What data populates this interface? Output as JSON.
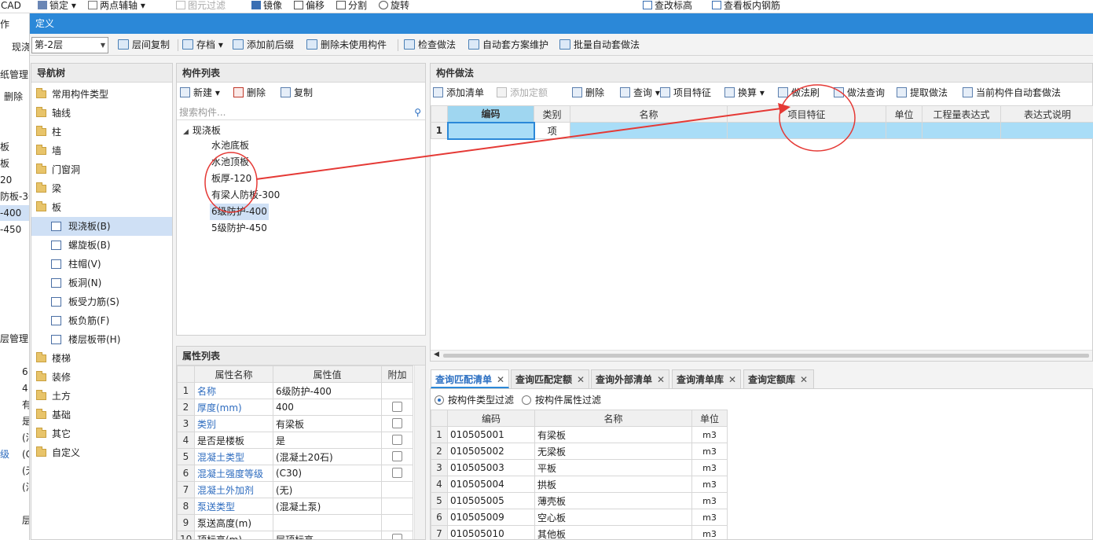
{
  "ribbon": {
    "items": [
      "CAD",
      "锁定",
      "两点辅轴",
      "图元过滤",
      "镜像",
      "偏移",
      "分割",
      "旋转",
      "查改标高",
      "查看板内钢筋"
    ]
  },
  "window": {
    "title": "定义"
  },
  "left_strip": {
    "items": [
      "作",
      "现浇",
      "纸管理",
      "删除",
      "板",
      "板",
      "20",
      "防板-30",
      "-400",
      "-450",
      "层管理",
      "6",
      "4",
      "有",
      "是",
      "(泊",
      "级",
      "(C",
      "(无",
      "(泊",
      "层"
    ]
  },
  "toolbar": {
    "floor_select": "第-2层",
    "buttons": [
      "层间复制",
      "存档",
      "添加前后缀",
      "删除未使用构件",
      "检查做法",
      "自动套方案维护",
      "批量自动套做法"
    ]
  },
  "nav_tree": {
    "title": "导航树",
    "items": [
      {
        "label": "常用构件类型",
        "kind": "folder"
      },
      {
        "label": "轴线",
        "kind": "folder"
      },
      {
        "label": "柱",
        "kind": "folder"
      },
      {
        "label": "墙",
        "kind": "folder"
      },
      {
        "label": "门窗洞",
        "kind": "folder"
      },
      {
        "label": "梁",
        "kind": "folder"
      },
      {
        "label": "板",
        "kind": "folder"
      },
      {
        "label": "现浇板(B)",
        "kind": "sub",
        "selected": true
      },
      {
        "label": "螺旋板(B)",
        "kind": "sub"
      },
      {
        "label": "柱帽(V)",
        "kind": "sub"
      },
      {
        "label": "板洞(N)",
        "kind": "sub"
      },
      {
        "label": "板受力筋(S)",
        "kind": "sub"
      },
      {
        "label": "板负筋(F)",
        "kind": "sub"
      },
      {
        "label": "楼层板带(H)",
        "kind": "sub"
      },
      {
        "label": "楼梯",
        "kind": "folder"
      },
      {
        "label": "装修",
        "kind": "folder"
      },
      {
        "label": "土方",
        "kind": "folder"
      },
      {
        "label": "基础",
        "kind": "folder"
      },
      {
        "label": "其它",
        "kind": "folder"
      },
      {
        "label": "自定义",
        "kind": "folder"
      }
    ]
  },
  "component_list": {
    "title": "构件列表",
    "new_label": "新建",
    "delete_label": "删除",
    "copy_label": "复制",
    "search_placeholder": "搜索构件...",
    "root": "现浇板",
    "items": [
      {
        "label": "水池底板"
      },
      {
        "label": "水池顶板"
      },
      {
        "label": "板厚-120"
      },
      {
        "label": "有梁人防板-300"
      },
      {
        "label": "6级防护-400",
        "selected": true
      },
      {
        "label": "5级防护-450"
      }
    ]
  },
  "properties": {
    "title": "属性列表",
    "headers": [
      "属性名称",
      "属性值",
      "附加"
    ],
    "rows": [
      {
        "num": "1",
        "name": "名称",
        "value": "6级防护-400",
        "link": true,
        "check": false
      },
      {
        "num": "2",
        "name": "厚度(mm)",
        "value": "400",
        "link": true,
        "check": true
      },
      {
        "num": "3",
        "name": "类别",
        "value": "有梁板",
        "link": true,
        "check": true
      },
      {
        "num": "4",
        "name": "是否是楼板",
        "value": "是",
        "link": false,
        "check": true
      },
      {
        "num": "5",
        "name": "混凝土类型",
        "value": "(混凝土20石)",
        "link": true,
        "check": true
      },
      {
        "num": "6",
        "name": "混凝土强度等级",
        "value": "(C30)",
        "link": true,
        "check": true
      },
      {
        "num": "7",
        "name": "混凝土外加剂",
        "value": "(无)",
        "link": true,
        "check": false
      },
      {
        "num": "8",
        "name": "泵送类型",
        "value": "(混凝土泵)",
        "link": true,
        "check": false
      },
      {
        "num": "9",
        "name": "泵送高度(m)",
        "value": "",
        "link": false,
        "check": false
      },
      {
        "num": "10",
        "name": "顶标高(m)",
        "value": "层顶标高",
        "link": false,
        "check": true
      }
    ]
  },
  "methods": {
    "title": "构件做法",
    "tools": [
      "添加清单",
      "添加定额",
      "删除",
      "查询",
      "项目特征",
      "换算",
      "做法刷",
      "做法查询",
      "提取做法",
      "当前构件自动套做法"
    ],
    "headers": [
      "编码",
      "类别",
      "名称",
      "项目特征",
      "单位",
      "工程量表达式",
      "表达式说明"
    ],
    "rows": [
      {
        "num": "1",
        "code": "",
        "type": "项",
        "name": "",
        "feature": "",
        "unit": "",
        "expr": "",
        "desc": ""
      }
    ]
  },
  "query": {
    "tabs": [
      "查询匹配清单",
      "查询匹配定额",
      "查询外部清单",
      "查询清单库",
      "查询定额库"
    ],
    "filter_type": "按构件类型过滤",
    "filter_attr": "按构件属性过滤",
    "headers": [
      "编码",
      "名称",
      "单位"
    ],
    "rows": [
      {
        "num": "1",
        "code": "010505001",
        "name": "有梁板",
        "unit": "m3"
      },
      {
        "num": "2",
        "code": "010505002",
        "name": "无梁板",
        "unit": "m3"
      },
      {
        "num": "3",
        "code": "010505003",
        "name": "平板",
        "unit": "m3"
      },
      {
        "num": "4",
        "code": "010505004",
        "name": "拱板",
        "unit": "m3"
      },
      {
        "num": "5",
        "code": "010505005",
        "name": "薄壳板",
        "unit": "m3"
      },
      {
        "num": "6",
        "code": "010505009",
        "name": "空心板",
        "unit": "m3"
      },
      {
        "num": "7",
        "code": "010505010",
        "name": "其他板",
        "unit": "m3"
      }
    ]
  },
  "colors": {
    "accent": "#2b88d8",
    "selected_row": "#a9ddf7",
    "annotation": "#e53935"
  }
}
